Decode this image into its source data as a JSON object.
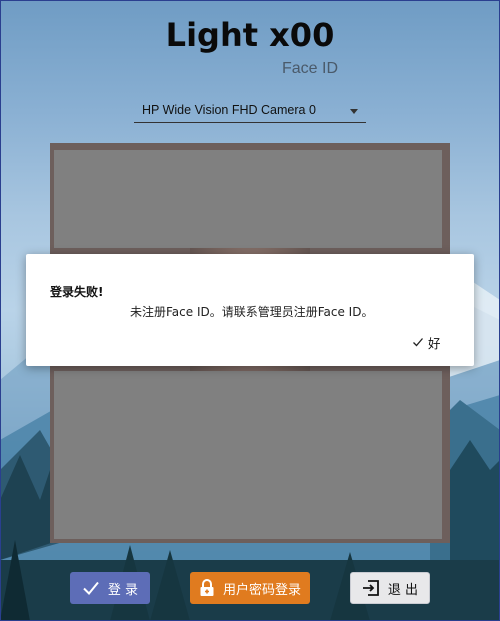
{
  "app": {
    "title": "Light x00",
    "subtitle": "Face ID"
  },
  "camera": {
    "selected": "HP Wide Vision FHD Camera 0"
  },
  "dialog": {
    "title": "登录失败!",
    "message": "未注册Face ID。请联系管理员注册Face ID。",
    "ok_label": "好"
  },
  "buttons": {
    "login_label": "登 录",
    "password_login_label": "用户密码登录",
    "exit_label": "退 出"
  },
  "colors": {
    "login": "#5d6db7",
    "password_login": "#e07b1f",
    "exit": "#e8e8ea",
    "mask": "#808080"
  },
  "icons": {
    "login": "check-icon",
    "password_login": "lock-icon",
    "exit": "exit-icon",
    "ok": "check-icon",
    "camera_select": "chevron-down-icon"
  }
}
